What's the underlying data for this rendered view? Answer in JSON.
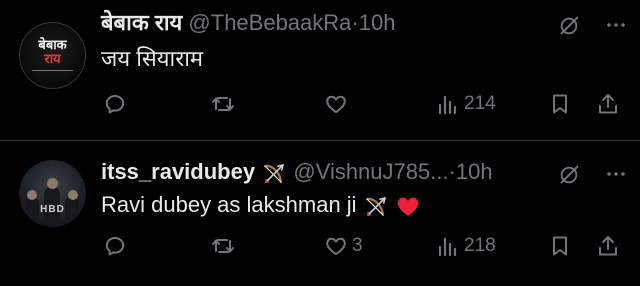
{
  "tweets": [
    {
      "avatar": {
        "line1": "बेबाक",
        "line2": "राय"
      },
      "name": "बेबाक राय",
      "handle": "@TheBebaakRa",
      "separator": "·",
      "time": "10h",
      "text": "जय सियाराम",
      "stats": {
        "replies": "",
        "reposts": "",
        "likes": "",
        "views": "214"
      }
    },
    {
      "avatar": {
        "line1": "HBD"
      },
      "name": "itss_ravidubey",
      "handle": "@VishnuJ785...",
      "separator": "·",
      "time": "10h",
      "text": "Ravi dubey as lakshman ji",
      "stats": {
        "replies": "",
        "reposts": "",
        "likes": "3",
        "views": "218"
      }
    }
  ],
  "icons": {
    "grok": "grok-icon",
    "more": "more-icon",
    "reply": "reply-icon",
    "repost": "repost-icon",
    "like": "heart-icon",
    "views": "views-icon",
    "bookmark": "bookmark-icon",
    "share": "share-icon",
    "bow": "bow-and-arrow-icon",
    "red_heart": "red-heart-icon"
  },
  "colors": {
    "background": "#000000",
    "text": "#e7e9ea",
    "muted": "#71767b",
    "divider": "#2f3336",
    "heart": "#e0245e"
  }
}
